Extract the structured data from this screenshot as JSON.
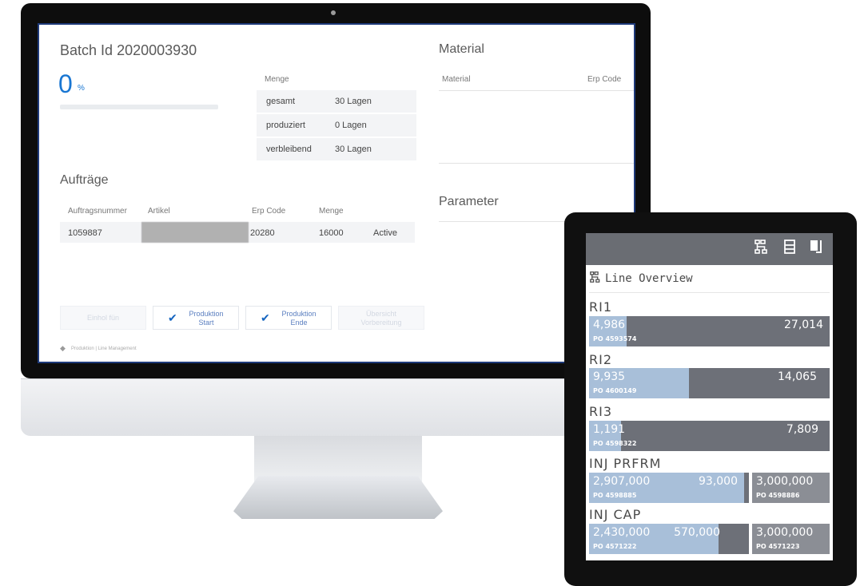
{
  "monitor": {
    "batch": {
      "label": "Batch Id",
      "id": "2020003930"
    },
    "progress": {
      "value": "0",
      "unit": "%",
      "fraction": 0
    },
    "menge": {
      "header": "Menge",
      "rows": [
        {
          "label": "gesamt",
          "value": "30 Lagen"
        },
        {
          "label": "produziert",
          "value": "0 Lagen"
        },
        {
          "label": "verbleibend",
          "value": "30 Lagen"
        }
      ]
    },
    "material": {
      "title": "Material",
      "columns": [
        "Material",
        "Erp Code"
      ]
    },
    "parameter": {
      "title": "Parameter"
    },
    "auftraege": {
      "title": "Aufträge",
      "columns": [
        "Auftragsnummer",
        "Artikel",
        "Erp Code",
        "Menge"
      ],
      "rows": [
        {
          "auftragsnummer": "1059887",
          "artikel": "",
          "erp_code": "20280",
          "menge": "16000",
          "status": "Active"
        }
      ]
    },
    "buttons": {
      "default": "Einhol fün",
      "produktion_start": [
        "Produktion",
        "Start"
      ],
      "produktion_ende": [
        "Produktion",
        "Ende"
      ],
      "last": [
        "Übersicht",
        "Vorbereitung"
      ]
    },
    "footer": "Produktion | Line Management"
  },
  "tablet": {
    "topbar_icons": [
      "hierarchy-icon",
      "list-icon",
      "exit-icon"
    ],
    "title": "Line Overview",
    "title_icon": "hierarchy-icon",
    "colors": {
      "fill": "#a8bfd9",
      "track": "#6d7078",
      "topbar": "#6a6d73"
    },
    "lines": [
      {
        "name": "RI1",
        "produced": "4,986",
        "remaining": "27,014",
        "po": "PO 4593574",
        "fraction": 0.156
      },
      {
        "name": "RI2",
        "produced": "9,935",
        "remaining": "14,065",
        "po": "PO 4600149",
        "fraction": 0.414
      },
      {
        "name": "RI3",
        "produced": "1,191",
        "remaining": "7,809",
        "po": "PO 4598322",
        "fraction": 0.132
      },
      {
        "name": "INJ PRFRM",
        "produced": "2,907,000",
        "remaining": "93,000",
        "po": "PO 4598885",
        "fraction": 0.969,
        "next": {
          "value": "3,000,000",
          "po": "PO 4598886"
        }
      },
      {
        "name": "INJ CAP",
        "produced": "2,430,000",
        "remaining": "570,000",
        "po": "PO 4571222",
        "fraction": 0.81,
        "next": {
          "value": "3,000,000",
          "po": "PO 4571223"
        }
      }
    ]
  }
}
